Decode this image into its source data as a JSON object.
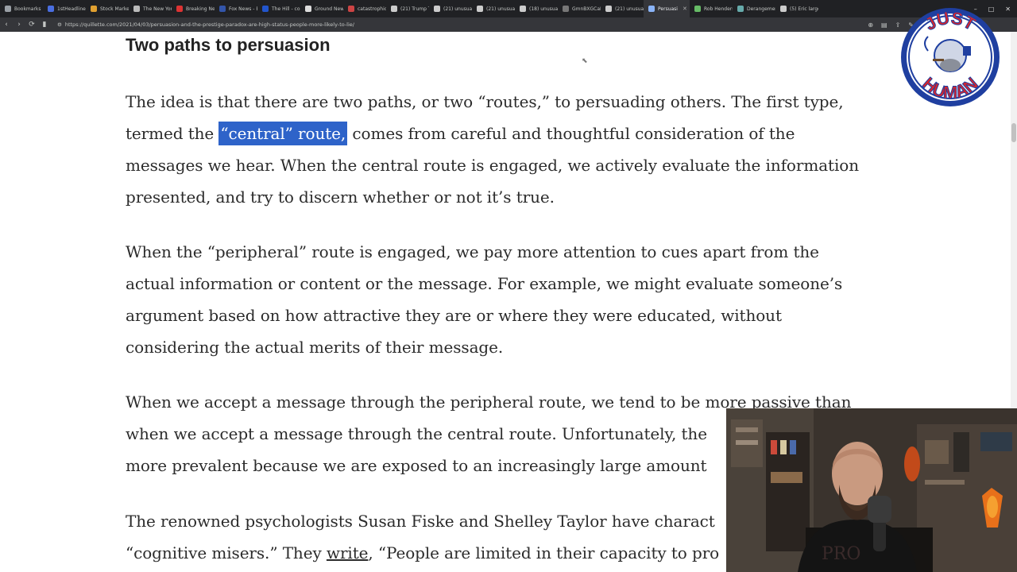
{
  "browser": {
    "tabs": [
      {
        "label": "Bookmarks",
        "color": "#9aa0a6"
      },
      {
        "label": "1stHeadlines",
        "color": "#4a6ee0"
      },
      {
        "label": "Stock Market",
        "color": "#e0a030"
      },
      {
        "label": "The New York",
        "color": "#bbbbbb"
      },
      {
        "label": "Breaking New",
        "color": "#d33"
      },
      {
        "label": "Fox News - B",
        "color": "#3355aa"
      },
      {
        "label": "The Hill - con",
        "color": "#2255cc"
      },
      {
        "label": "Ground News",
        "color": "#dddddd"
      },
      {
        "label": "catastrophic",
        "color": "#cc4444"
      },
      {
        "label": "(21) Trump Tr",
        "color": "#cccccc"
      },
      {
        "label": "(21) unusual",
        "color": "#cccccc"
      },
      {
        "label": "(21) unusual",
        "color": "#cccccc"
      },
      {
        "label": "(18) unusual",
        "color": "#cccccc"
      },
      {
        "label": "GmnBXGCaN",
        "color": "#777777"
      },
      {
        "label": "(21) unusual",
        "color": "#cccccc"
      },
      {
        "label": "Persuasi",
        "color": "#8ab4f8",
        "active": true
      },
      {
        "label": "Rob Henders",
        "color": "#66bb66"
      },
      {
        "label": "Derangemen",
        "color": "#66aaaa"
      },
      {
        "label": "(5) Eric larger",
        "color": "#cccccc"
      }
    ],
    "url": "https://quillette.com/2021/04/03/persuasion-and-the-prestige-paradox-are-high-status-people-more-likely-to-lie/",
    "window_controls": [
      "–",
      "□",
      "✕"
    ]
  },
  "article": {
    "heading": "Two paths to persuasion",
    "p1": {
      "line1": "The idea is that there are two paths, or two “routes,” to persuading others. The first type,",
      "line2_pre": "termed the ",
      "line2_highlight": "“central” route,",
      "line2_post": " comes from careful and thoughtful consideration of the",
      "line3": "messages we hear. When the central route is engaged, we actively evaluate the information",
      "line4": "presented, and try to discern whether or not it’s true."
    },
    "p2": {
      "line1": "When the “peripheral” route is engaged, we pay more attention to cues apart from the",
      "line2": "actual information or content or the message. For example, we might evaluate someone’s",
      "line3": "argument based on how attractive they are or where they were educated, without",
      "line4": "considering the actual merits of their message."
    },
    "p3": {
      "line1": "When we accept a message through the peripheral route, we tend to be more passive than",
      "line2": "when we accept a message through the central route. Unfortunately, the",
      "line3": "more prevalent because we are exposed to an increasingly large amount"
    },
    "p4": {
      "line1": "The renowned psychologists Susan Fiske and Shelley Taylor have charact",
      "line2_pre": "“cognitive misers.” They ",
      "line2_link": "write",
      "line2_post": ", “People are limited in their capacity to pro"
    }
  },
  "logo": {
    "top_text": "JUST",
    "bottom_text": "HUMAN",
    "colors": {
      "outer": "#1f3fa0",
      "text": "#d9262c",
      "inner": "#ffffff"
    }
  },
  "webcam": {
    "shirt_text": "PRO"
  },
  "colors": {
    "highlight": "#2e63c9",
    "tabbar": "#202124",
    "toolbar": "#35363a"
  }
}
